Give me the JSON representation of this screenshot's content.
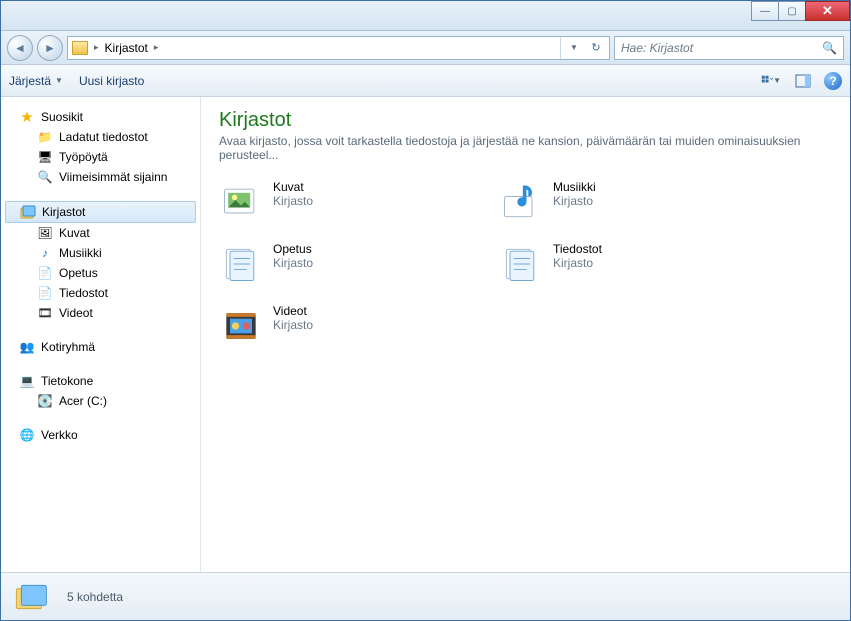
{
  "breadcrumb": {
    "root_sep": "▸",
    "location": "Kirjastot",
    "sep": "▸"
  },
  "search": {
    "placeholder": "Hae: Kirjastot"
  },
  "toolbar": {
    "organize": "Järjestä",
    "new_library": "Uusi kirjasto"
  },
  "sidebar": {
    "favorites": {
      "label": "Suosikit",
      "items": [
        "Ladatut tiedostot",
        "Työpöytä",
        "Viimeisimmät sijainn"
      ]
    },
    "libraries": {
      "label": "Kirjastot",
      "items": [
        "Kuvat",
        "Musiikki",
        "Opetus",
        "Tiedostot",
        "Videot"
      ]
    },
    "homegroup": {
      "label": "Kotiryhmä"
    },
    "computer": {
      "label": "Tietokone",
      "drives": [
        "Acer (C:)"
      ]
    },
    "network": {
      "label": "Verkko"
    }
  },
  "main": {
    "title": "Kirjastot",
    "description": "Avaa kirjasto, jossa voit tarkastella tiedostoja ja järjestää ne kansion, päivämäärän tai muiden ominaisuuksien perusteel...",
    "type_label": "Kirjasto",
    "items": [
      {
        "name": "Kuvat",
        "kind": "pictures"
      },
      {
        "name": "Musiikki",
        "kind": "music"
      },
      {
        "name": "Opetus",
        "kind": "docs"
      },
      {
        "name": "Tiedostot",
        "kind": "docs"
      },
      {
        "name": "Videot",
        "kind": "videos"
      }
    ]
  },
  "status": {
    "text": "5 kohdetta"
  }
}
